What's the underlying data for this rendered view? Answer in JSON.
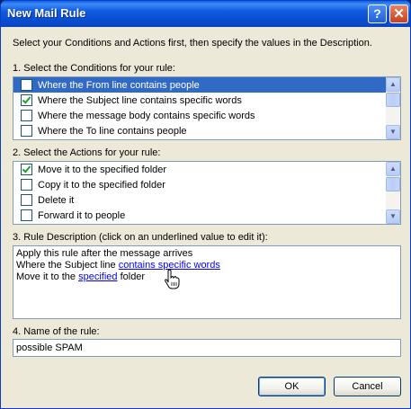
{
  "window": {
    "title": "New Mail Rule"
  },
  "titlebar_buttons": {
    "help": "?",
    "close": "✕"
  },
  "intro": "Select your Conditions and Actions first, then specify the values in the Description.",
  "conditions": {
    "label": "1. Select the Conditions for your rule:",
    "items": [
      {
        "label": "Where the From line contains people",
        "checked": false,
        "selected": true
      },
      {
        "label": "Where the Subject line contains specific words",
        "checked": true,
        "selected": false
      },
      {
        "label": "Where the message body contains specific words",
        "checked": false,
        "selected": false
      },
      {
        "label": "Where the To line contains people",
        "checked": false,
        "selected": false
      }
    ]
  },
  "actions": {
    "label": "2. Select the Actions for your rule:",
    "items": [
      {
        "label": "Move it to the specified folder",
        "checked": true,
        "selected": false
      },
      {
        "label": "Copy it to the specified folder",
        "checked": false,
        "selected": false
      },
      {
        "label": "Delete it",
        "checked": false,
        "selected": false
      },
      {
        "label": "Forward it to people",
        "checked": false,
        "selected": false
      }
    ]
  },
  "description": {
    "label": "3. Rule Description (click on an underlined value to edit it):",
    "line1": "Apply this rule after the message arrives",
    "line2_prefix": "Where the Subject line ",
    "line2_link": "contains specific words",
    "line3_prefix": "Move it to the ",
    "line3_link": "specified",
    "line3_suffix": " folder"
  },
  "name": {
    "label": "4. Name of the rule:",
    "value": "possible SPAM"
  },
  "buttons": {
    "ok": "OK",
    "cancel": "Cancel"
  },
  "icons": {
    "cursor": "hand-pointer-icon",
    "scroll_up": "chevron-up-icon",
    "scroll_down": "chevron-down-icon"
  },
  "colors": {
    "titlebar": "#0a5fe8",
    "selection": "#316ac5",
    "link": "#0000ff",
    "dialog_bg": "#ece9d8"
  }
}
